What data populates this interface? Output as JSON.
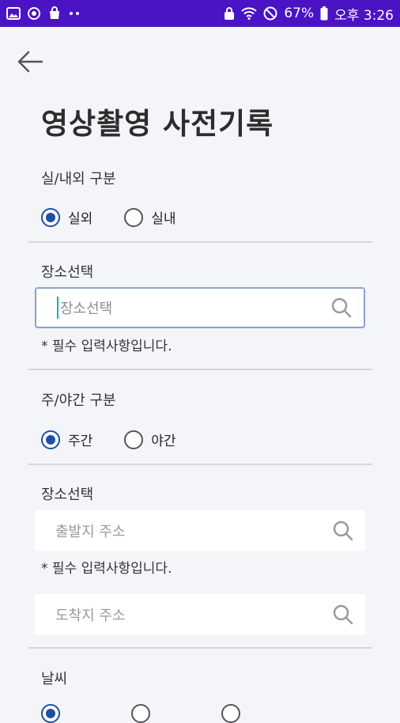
{
  "status_bar": {
    "battery": "67%",
    "time": "오후 3:26",
    "colors": {
      "bar": "#4a13c4",
      "icons": "#ffffff"
    }
  },
  "page": {
    "title": "영상촬영 사전기록"
  },
  "indoor_outdoor": {
    "label": "실/내외 구분",
    "options": [
      {
        "label": "실외",
        "checked": true
      },
      {
        "label": "실내",
        "checked": false
      }
    ]
  },
  "location": {
    "label": "장소선택",
    "placeholder": "장소선택",
    "required_note": "* 필수 입력사항입니다."
  },
  "day_night": {
    "label": "주/야간 구분",
    "options": [
      {
        "label": "주간",
        "checked": true
      },
      {
        "label": "야간",
        "checked": false
      }
    ]
  },
  "route": {
    "label": "장소선택",
    "departure_placeholder": "출발지 주소",
    "required_note": "* 필수 입력사항입니다.",
    "arrival_placeholder": "도착지 주소"
  },
  "weather": {
    "label": "날씨"
  },
  "accent_color": "#1f4fa3"
}
